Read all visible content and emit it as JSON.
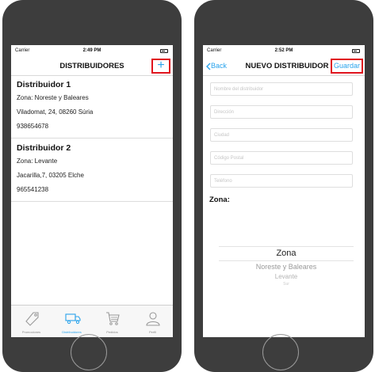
{
  "left_screen": {
    "status": {
      "carrier": "Carrier",
      "time": "2:49 PM"
    },
    "title": "DISTRIBUIDORES",
    "add_label": "+",
    "distributors": [
      {
        "name": "Distribuidor 1",
        "zone": "Zona: Noreste y Baleares",
        "address": "Viladomat, 24, 08260 Súria",
        "phone": "938654678"
      },
      {
        "name": "Distribuidor 2",
        "zone": "Zona: Levante",
        "address": "Jacarilla,7, 03205 Elche",
        "phone": "965541238"
      }
    ],
    "tabs": [
      {
        "label": "Promociones",
        "icon": "tag-icon"
      },
      {
        "label": "Distribuidores",
        "icon": "truck-icon",
        "active": true
      },
      {
        "label": "Pedidos",
        "icon": "cart-icon"
      },
      {
        "label": "Perfil",
        "icon": "user-icon"
      }
    ],
    "accent_color": "#29a3ec",
    "highlight_color": "#e0141e"
  },
  "right_screen": {
    "status": {
      "carrier": "Carrier",
      "time": "2:52 PM"
    },
    "back_label": "Back",
    "title": "NUEVO DISTRIBUIDOR",
    "save_label": "Guardar",
    "fields": [
      {
        "placeholder": "Nombre del distribuidor"
      },
      {
        "placeholder": "Dirección"
      },
      {
        "placeholder": "Ciudad"
      },
      {
        "placeholder": "Código Postal"
      },
      {
        "placeholder": "Teléfono"
      }
    ],
    "zona_label": "Zona:",
    "picker": {
      "selected": "Zona",
      "options": [
        "Noreste y Baleares",
        "Levante",
        "Sur"
      ]
    }
  }
}
